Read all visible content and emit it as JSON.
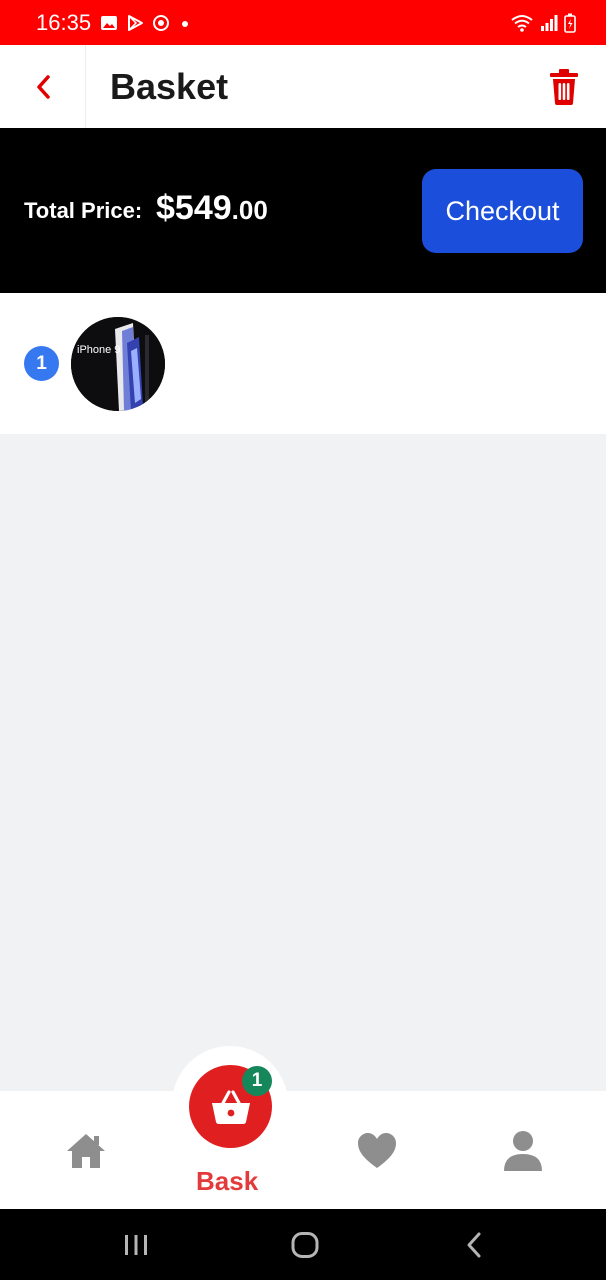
{
  "status_bar": {
    "time": "16:35",
    "left_icons": [
      "gallery-icon",
      "play-store-icon",
      "sync-icon",
      "dot-icon"
    ],
    "right_icons": [
      "wifi-icon",
      "signal-icon",
      "battery-charging-icon"
    ],
    "background": "#ff0000"
  },
  "header": {
    "back_icon": "chevron-left-icon",
    "title": "Basket",
    "delete_icon": "trash-icon",
    "accent_color": "#e00000"
  },
  "summary": {
    "total_label": "Total Price:",
    "price_main": "$549",
    "price_cents": ".00",
    "checkout_label": "Checkout",
    "checkout_color": "#1b4fdb"
  },
  "items": [
    {
      "quantity": "1",
      "thumbnail_text": "iPhone 9",
      "thumbnail_icon": "product-image"
    }
  ],
  "bottom_nav": {
    "items": [
      {
        "icon": "home-icon",
        "active": false
      },
      {
        "icon": "basket-icon",
        "label": "Bask",
        "badge": "1",
        "active": true
      },
      {
        "icon": "heart-icon",
        "active": false
      },
      {
        "icon": "user-icon",
        "active": false
      }
    ],
    "active_color": "#e02020",
    "inactive_color": "#8e8e8e",
    "badge_color": "#16875a"
  },
  "system_nav": {
    "buttons": [
      "recents-icon",
      "home-circle-icon",
      "back-icon"
    ]
  }
}
